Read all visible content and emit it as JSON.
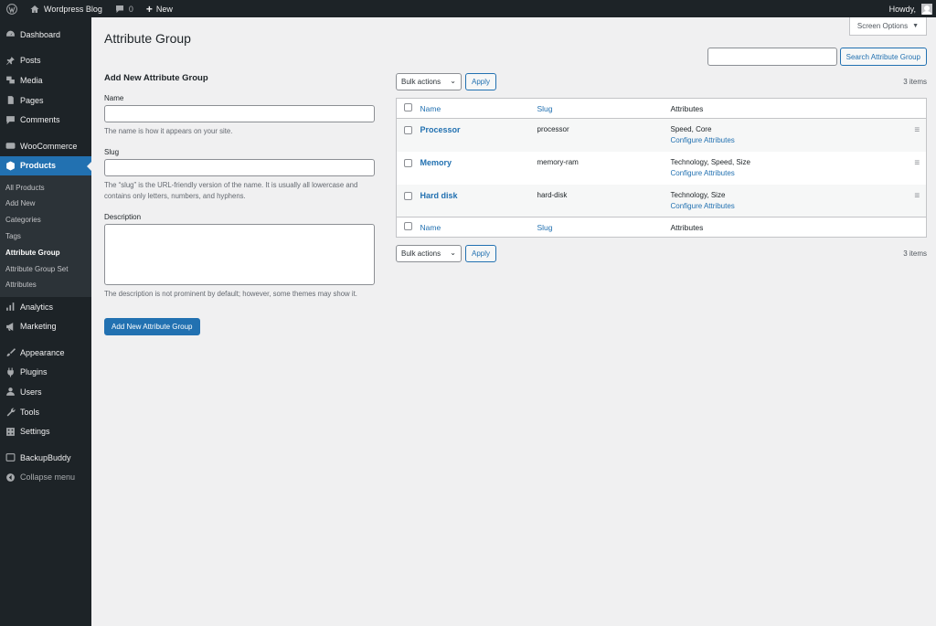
{
  "adminbar": {
    "site_name": "Wordpress Blog",
    "comments_count": "0",
    "new_label": "New",
    "greeting": "Howdy,"
  },
  "sidebar": {
    "dashboard": "Dashboard",
    "posts": "Posts",
    "media": "Media",
    "pages": "Pages",
    "comments": "Comments",
    "woocommerce": "WooCommerce",
    "products": "Products",
    "submenu": [
      "All Products",
      "Add New",
      "Categories",
      "Tags",
      "Attribute Group",
      "Attribute Group Set",
      "Attributes"
    ],
    "analytics": "Analytics",
    "marketing": "Marketing",
    "appearance": "Appearance",
    "plugins": "Plugins",
    "users": "Users",
    "tools": "Tools",
    "settings": "Settings",
    "backupbuddy": "BackupBuddy",
    "collapse": "Collapse menu"
  },
  "screen_options": "Screen Options",
  "page_title": "Attribute Group",
  "search": {
    "button_label": "Search Attribute Group",
    "value": ""
  },
  "form": {
    "title": "Add New Attribute Group",
    "name_label": "Name",
    "name_desc": "The name is how it appears on your site.",
    "slug_label": "Slug",
    "slug_desc": "The “slug” is the URL-friendly version of the name. It is usually all lowercase and contains only letters, numbers, and hyphens.",
    "description_label": "Description",
    "description_desc": "The description is not prominent by default; however, some themes may show it.",
    "submit_label": "Add New Attribute Group"
  },
  "tablenav": {
    "bulk_actions": "Bulk actions",
    "apply": "Apply",
    "items_count": "3 items"
  },
  "table": {
    "columns": {
      "name": "Name",
      "slug": "Slug",
      "attributes": "Attributes"
    },
    "configure_label": "Configure Attributes",
    "rows": [
      {
        "name": "Processor",
        "slug": "processor",
        "attributes": "Speed, Core"
      },
      {
        "name": "Memory",
        "slug": "memory-ram",
        "attributes": "Technology, Speed, Size"
      },
      {
        "name": "Hard disk",
        "slug": "hard-disk",
        "attributes": "Technology, Size"
      }
    ]
  }
}
